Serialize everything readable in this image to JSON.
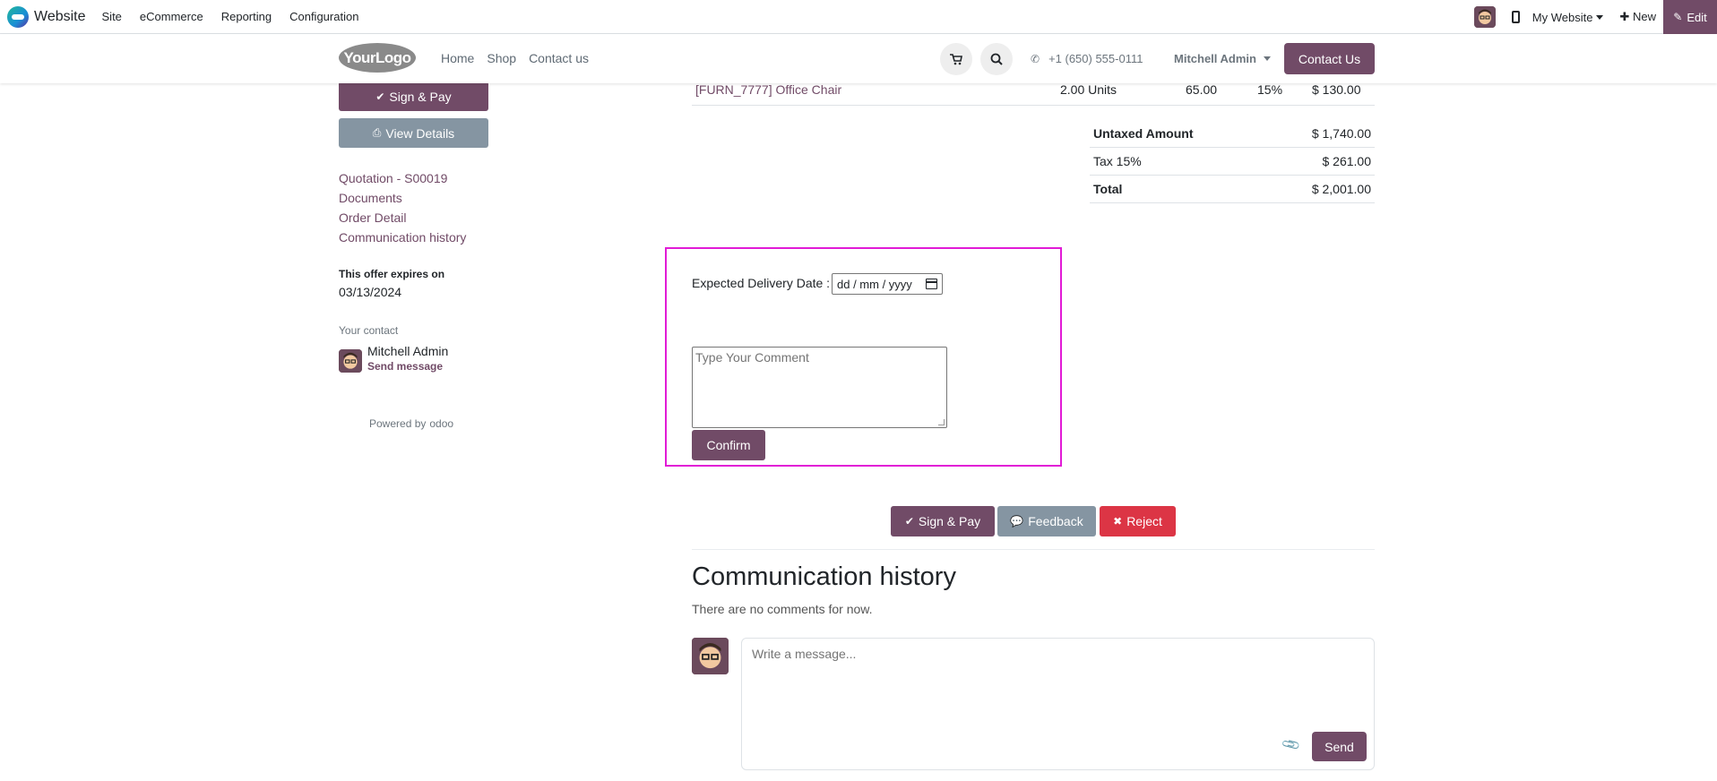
{
  "admin_bar": {
    "app_name": "Website",
    "menu": [
      "Site",
      "eCommerce",
      "Reporting",
      "Configuration"
    ],
    "website_selector": "My Website",
    "new_label": "New",
    "edit_label": "Edit"
  },
  "header": {
    "logo_text": "YourLogo",
    "nav": [
      "Home",
      "Shop",
      "Contact us"
    ],
    "phone": "+1 (650) 555-0111",
    "user": "Mitchell Admin",
    "contact_button": "Contact Us"
  },
  "sidebar": {
    "sign_pay": "Sign & Pay",
    "view_details": "View Details",
    "links": [
      "Quotation - S00019",
      "Documents",
      "Order Detail",
      "Communication history"
    ],
    "expires_label": "This offer expires on",
    "expires_date": "03/13/2024",
    "contact_label": "Your contact",
    "contact_name": "Mitchell Admin",
    "send_message": "Send message",
    "powered_by": "Powered by",
    "odoo": "odoo"
  },
  "order": {
    "line": {
      "product": "[FURN_7777] Office Chair",
      "quantity": "2.00 Units",
      "unit_price": "65.00",
      "tax": "15%",
      "subtotal": "$ 130.00"
    },
    "totals": [
      {
        "label": "Untaxed Amount",
        "value": "$ 1,740.00"
      },
      {
        "label": "Tax 15%",
        "value": "$ 261.00"
      },
      {
        "label": "Total",
        "value": "$ 2,001.00"
      }
    ]
  },
  "form": {
    "date_label": "Expected Delivery Date :",
    "date_placeholder": "dd / mm / yyyy",
    "comment_placeholder": "Type Your Comment",
    "confirm": "Confirm"
  },
  "actions": {
    "sign_pay": "Sign & Pay",
    "feedback": "Feedback",
    "reject": "Reject"
  },
  "communication": {
    "title": "Communication history",
    "empty_text": "There are no comments for now.",
    "message_placeholder": "Write a message...",
    "send": "Send"
  },
  "colors": {
    "brand": "#714b67",
    "secondary": "#8595a2",
    "danger": "#dc3545",
    "highlight": "#e11bd6"
  }
}
